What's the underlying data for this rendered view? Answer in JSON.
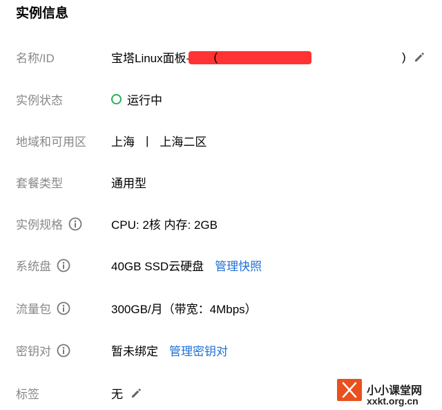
{
  "section_title": "实例信息",
  "rows": {
    "name": {
      "label": "名称/ID",
      "value_prefix": "宝塔Linux面板-",
      "value_open": "(",
      "value_close": ")"
    },
    "status": {
      "label": "实例状态",
      "value": "运行中",
      "status_color": "#22b157"
    },
    "region": {
      "label": "地域和可用区",
      "region": "上海",
      "separator": "|",
      "zone": "上海二区"
    },
    "plan_type": {
      "label": "套餐类型",
      "value": "通用型"
    },
    "spec": {
      "label": "实例规格",
      "value": "CPU: 2核 内存: 2GB"
    },
    "system_disk": {
      "label": "系统盘",
      "value": "40GB SSD云硬盘",
      "link": "管理快照"
    },
    "traffic": {
      "label": "流量包",
      "value": "300GB/月（带宽：4Mbps）"
    },
    "key_pair": {
      "label": "密钥对",
      "value": "暂未绑定",
      "link": "管理密钥对"
    },
    "tags": {
      "label": "标签",
      "value": "无"
    }
  },
  "colors": {
    "link": "#1f6fd6",
    "label": "#888888",
    "redaction": "#ff3333",
    "watermark_accent": "#e8511e"
  },
  "watermark": {
    "brand": "小小课堂网",
    "url": "xxkt.org.cn"
  }
}
